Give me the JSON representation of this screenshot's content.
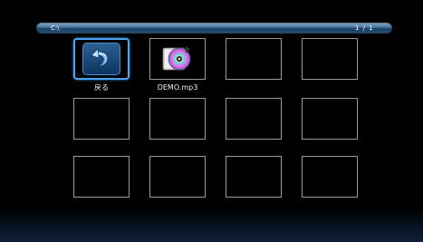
{
  "path_bar": {
    "path": "C:\\",
    "page": "1 / 1"
  },
  "items": [
    {
      "label": "戻る",
      "icon": "back-arrow-icon",
      "selected": true
    },
    {
      "label": "DEMO.mp3",
      "icon": "music-file-icon",
      "selected": false
    },
    {
      "label": "",
      "icon": "",
      "selected": false
    },
    {
      "label": "",
      "icon": "",
      "selected": false
    },
    {
      "label": "",
      "icon": "",
      "selected": false
    },
    {
      "label": "",
      "icon": "",
      "selected": false
    },
    {
      "label": "",
      "icon": "",
      "selected": false
    },
    {
      "label": "",
      "icon": "",
      "selected": false
    },
    {
      "label": "",
      "icon": "",
      "selected": false
    },
    {
      "label": "",
      "icon": "",
      "selected": false
    },
    {
      "label": "",
      "icon": "",
      "selected": false
    },
    {
      "label": "",
      "icon": "",
      "selected": false
    }
  ],
  "colors": {
    "selection": "#4aa4ef",
    "cell_border": "#9a9a9a",
    "bar_accent": "#3f6f97"
  }
}
